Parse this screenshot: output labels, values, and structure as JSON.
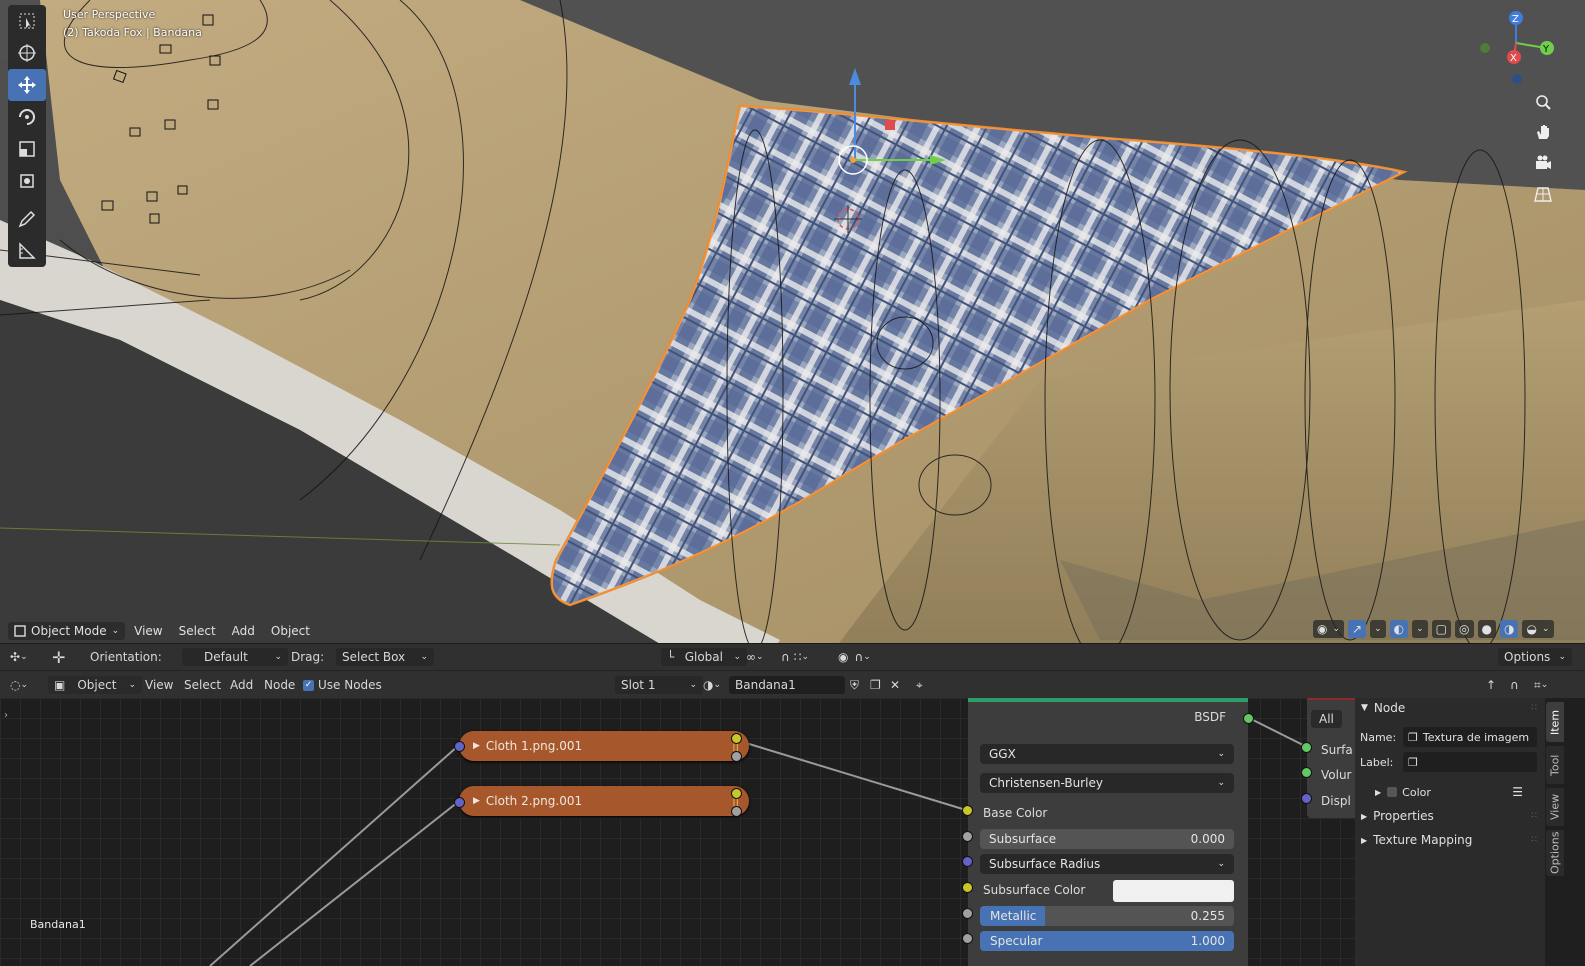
{
  "viewport": {
    "perspective_label": "User Perspective",
    "object_label": "(2) Takoda Fox | Bandana",
    "mode_label": "Object Mode",
    "menus": [
      "View",
      "Select",
      "Add",
      "Object"
    ]
  },
  "tool_settings": {
    "orientation_label": "Orientation:",
    "orientation_value": "Default",
    "drag_label": "Drag:",
    "drag_value": "Select Box",
    "transform_space": "Global",
    "options_label": "Options"
  },
  "node_header": {
    "editor_type": "Object",
    "menus": [
      "View",
      "Select",
      "Add",
      "Node"
    ],
    "use_nodes_label": "Use Nodes",
    "slot_value": "Slot 1",
    "material_name": "Bandana1"
  },
  "node_editor": {
    "material_label": "Bandana1",
    "frame_nodes": [
      {
        "label": "Cloth 1.png.001"
      },
      {
        "label": "Cloth 2.png.001"
      }
    ],
    "bsdf": {
      "output_label": "BSDF",
      "distribution": "GGX",
      "subsurface_method": "Christensen-Burley",
      "inputs": {
        "base_color": "Base Color",
        "subsurface": {
          "label": "Subsurface",
          "value": "0.000"
        },
        "subsurface_radius": "Subsurface Radius",
        "subsurface_color": "Subsurface Color",
        "metallic": {
          "label": "Metallic",
          "value": "0.255",
          "fraction": 0.255
        },
        "specular": {
          "label": "Specular",
          "value": "1.000",
          "fraction": 1.0
        }
      }
    },
    "output_node": {
      "target": "All",
      "sockets": [
        "Surfa",
        "Volur",
        "Displ"
      ]
    }
  },
  "sidebar": {
    "section_title": "Node",
    "name_label": "Name:",
    "name_value": "Textura de imagem",
    "label_label": "Label:",
    "label_value": "",
    "color_label": "Color",
    "properties_label": "Properties",
    "texture_mapping_label": "Texture Mapping",
    "tabs": [
      "Item",
      "Tool",
      "View",
      "Options"
    ]
  },
  "colors": {
    "selection_outline": "#f08a2b",
    "accent_blue": "#4772b3",
    "frame_node": "#a6582c",
    "bsdf_header": "#2c9e69"
  }
}
